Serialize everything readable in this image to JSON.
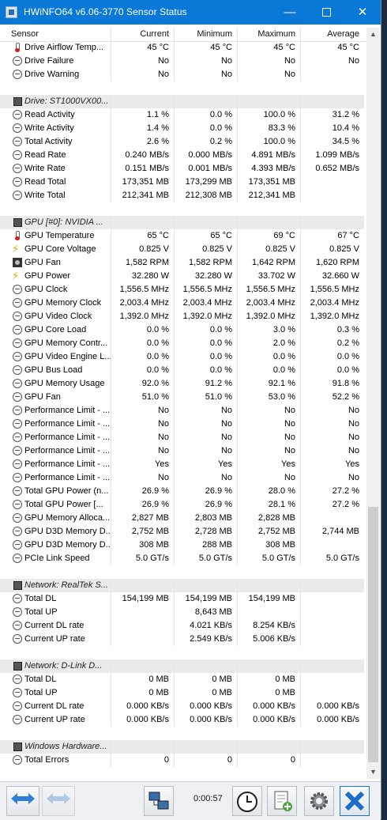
{
  "window": {
    "title": "HWiNFO64 v6.06-3770 Sensor Status",
    "minimize_glyph": "—",
    "close_glyph": "✕"
  },
  "columns": [
    "Sensor",
    "Current",
    "Minimum",
    "Maximum",
    "Average"
  ],
  "rows": [
    {
      "type": "sensor",
      "icon": "thermometer-icon",
      "label": "Drive Airflow Temp...",
      "v": [
        "45 °C",
        "45 °C",
        "45 °C",
        "45 °C"
      ]
    },
    {
      "type": "sensor",
      "icon": "clock-icon",
      "label": "Drive Failure",
      "v": [
        "No",
        "No",
        "No",
        "No"
      ]
    },
    {
      "type": "sensor",
      "icon": "clock-icon",
      "label": "Drive Warning",
      "v": [
        "No",
        "No",
        "No",
        ""
      ]
    },
    {
      "type": "blank"
    },
    {
      "type": "section",
      "icon": "drive-icon",
      "label": "Drive: ST1000VX00..."
    },
    {
      "type": "sensor",
      "icon": "clock-icon",
      "label": "Read Activity",
      "v": [
        "1.1 %",
        "0.0 %",
        "100.0 %",
        "31.2 %"
      ]
    },
    {
      "type": "sensor",
      "icon": "clock-icon",
      "label": "Write Activity",
      "v": [
        "1.4 %",
        "0.0 %",
        "83.3 %",
        "10.4 %"
      ]
    },
    {
      "type": "sensor",
      "icon": "clock-icon",
      "label": "Total Activity",
      "v": [
        "2.6 %",
        "0.2 %",
        "100.0 %",
        "34.5 %"
      ]
    },
    {
      "type": "sensor",
      "icon": "clock-icon",
      "label": "Read Rate",
      "v": [
        "0.240 MB/s",
        "0.000 MB/s",
        "4.891 MB/s",
        "1.099 MB/s"
      ]
    },
    {
      "type": "sensor",
      "icon": "clock-icon",
      "label": "Write Rate",
      "v": [
        "0.151 MB/s",
        "0.001 MB/s",
        "4.393 MB/s",
        "0.652 MB/s"
      ]
    },
    {
      "type": "sensor",
      "icon": "clock-icon",
      "label": "Read Total",
      "v": [
        "173,351 MB",
        "173,299 MB",
        "173,351 MB",
        ""
      ]
    },
    {
      "type": "sensor",
      "icon": "clock-icon",
      "label": "Write Total",
      "v": [
        "212,341 MB",
        "212,308 MB",
        "212,341 MB",
        ""
      ]
    },
    {
      "type": "blank"
    },
    {
      "type": "section",
      "icon": "gpu-icon",
      "label": "GPU [#0]: NVIDIA ..."
    },
    {
      "type": "sensor",
      "icon": "thermometer-icon",
      "label": "GPU Temperature",
      "v": [
        "65 °C",
        "65 °C",
        "69 °C",
        "67 °C"
      ]
    },
    {
      "type": "sensor",
      "icon": "voltage-icon",
      "label": "GPU Core Voltage",
      "v": [
        "0.825 V",
        "0.825 V",
        "0.825 V",
        "0.825 V"
      ]
    },
    {
      "type": "sensor",
      "icon": "fan-icon",
      "label": "GPU Fan",
      "v": [
        "1,582 RPM",
        "1,582 RPM",
        "1,642 RPM",
        "1,620 RPM"
      ]
    },
    {
      "type": "sensor",
      "icon": "voltage-icon",
      "label": "GPU Power",
      "v": [
        "32.280 W",
        "32.280 W",
        "33.702 W",
        "32.660 W"
      ]
    },
    {
      "type": "sensor",
      "icon": "clock-icon",
      "label": "GPU Clock",
      "v": [
        "1,556.5 MHz",
        "1,556.5 MHz",
        "1,556.5 MHz",
        "1,556.5 MHz"
      ]
    },
    {
      "type": "sensor",
      "icon": "clock-icon",
      "label": "GPU Memory Clock",
      "v": [
        "2,003.4 MHz",
        "2,003.4 MHz",
        "2,003.4 MHz",
        "2,003.4 MHz"
      ]
    },
    {
      "type": "sensor",
      "icon": "clock-icon",
      "label": "GPU Video Clock",
      "v": [
        "1,392.0 MHz",
        "1,392.0 MHz",
        "1,392.0 MHz",
        "1,392.0 MHz"
      ]
    },
    {
      "type": "sensor",
      "icon": "clock-icon",
      "label": "GPU Core Load",
      "v": [
        "0.0 %",
        "0.0 %",
        "3.0 %",
        "0.3 %"
      ]
    },
    {
      "type": "sensor",
      "icon": "clock-icon",
      "label": "GPU Memory Contr...",
      "v": [
        "0.0 %",
        "0.0 %",
        "2.0 %",
        "0.2 %"
      ]
    },
    {
      "type": "sensor",
      "icon": "clock-icon",
      "label": "GPU Video Engine L...",
      "v": [
        "0.0 %",
        "0.0 %",
        "0.0 %",
        "0.0 %"
      ]
    },
    {
      "type": "sensor",
      "icon": "clock-icon",
      "label": "GPU Bus Load",
      "v": [
        "0.0 %",
        "0.0 %",
        "0.0 %",
        "0.0 %"
      ]
    },
    {
      "type": "sensor",
      "icon": "clock-icon",
      "label": "GPU Memory Usage",
      "v": [
        "92.0 %",
        "91.2 %",
        "92.1 %",
        "91.8 %"
      ]
    },
    {
      "type": "sensor",
      "icon": "clock-icon",
      "label": "GPU Fan",
      "v": [
        "51.0 %",
        "51.0 %",
        "53.0 %",
        "52.2 %"
      ]
    },
    {
      "type": "sensor",
      "icon": "clock-icon",
      "label": "Performance Limit - ...",
      "v": [
        "No",
        "No",
        "No",
        "No"
      ]
    },
    {
      "type": "sensor",
      "icon": "clock-icon",
      "label": "Performance Limit - ...",
      "v": [
        "No",
        "No",
        "No",
        "No"
      ]
    },
    {
      "type": "sensor",
      "icon": "clock-icon",
      "label": "Performance Limit - ...",
      "v": [
        "No",
        "No",
        "No",
        "No"
      ]
    },
    {
      "type": "sensor",
      "icon": "clock-icon",
      "label": "Performance Limit - ...",
      "v": [
        "No",
        "No",
        "No",
        "No"
      ]
    },
    {
      "type": "sensor",
      "icon": "clock-icon",
      "label": "Performance Limit - ...",
      "v": [
        "Yes",
        "Yes",
        "Yes",
        "Yes"
      ]
    },
    {
      "type": "sensor",
      "icon": "clock-icon",
      "label": "Performance Limit - ...",
      "v": [
        "No",
        "No",
        "No",
        "No"
      ]
    },
    {
      "type": "sensor",
      "icon": "clock-icon",
      "label": "Total GPU Power (n...",
      "v": [
        "26.9 %",
        "26.9 %",
        "28.0 %",
        "27.2 %"
      ]
    },
    {
      "type": "sensor",
      "icon": "clock-icon",
      "label": "Total GPU Power [...",
      "v": [
        "26.9 %",
        "26.9 %",
        "28.1 %",
        "27.2 %"
      ]
    },
    {
      "type": "sensor",
      "icon": "clock-icon",
      "label": "GPU Memory Alloca...",
      "v": [
        "2,827 MB",
        "2,803 MB",
        "2,828 MB",
        ""
      ]
    },
    {
      "type": "sensor",
      "icon": "clock-icon",
      "label": "GPU D3D Memory D...",
      "v": [
        "2,752 MB",
        "2,728 MB",
        "2,752 MB",
        "2,744 MB"
      ]
    },
    {
      "type": "sensor",
      "icon": "clock-icon",
      "label": "GPU D3D Memory D...",
      "v": [
        "308 MB",
        "288 MB",
        "308 MB",
        ""
      ]
    },
    {
      "type": "sensor",
      "icon": "clock-icon",
      "label": "PCIe Link Speed",
      "v": [
        "5.0 GT/s",
        "5.0 GT/s",
        "5.0 GT/s",
        "5.0 GT/s"
      ]
    },
    {
      "type": "blank"
    },
    {
      "type": "section",
      "icon": "network-icon",
      "label": "Network: RealTek S..."
    },
    {
      "type": "sensor",
      "icon": "clock-icon",
      "label": "Total DL",
      "v": [
        "154,199 MB",
        "154,199 MB",
        "154,199 MB",
        ""
      ]
    },
    {
      "type": "sensor",
      "icon": "clock-icon",
      "label": "Total UP",
      "v": [
        "",
        "8,643 MB",
        "",
        ""
      ]
    },
    {
      "type": "sensor",
      "icon": "clock-icon",
      "label": "Current DL rate",
      "v": [
        "",
        "4.021 KB/s",
        "8.254 KB/s",
        ""
      ]
    },
    {
      "type": "sensor",
      "icon": "clock-icon",
      "label": "Current UP rate",
      "v": [
        "",
        "2.549 KB/s",
        "5.006 KB/s",
        ""
      ]
    },
    {
      "type": "blank"
    },
    {
      "type": "section",
      "icon": "network-icon",
      "label": "Network: D-Link D..."
    },
    {
      "type": "sensor",
      "icon": "clock-icon",
      "label": "Total DL",
      "v": [
        "0 MB",
        "0 MB",
        "0 MB",
        ""
      ]
    },
    {
      "type": "sensor",
      "icon": "clock-icon",
      "label": "Total UP",
      "v": [
        "0 MB",
        "0 MB",
        "0 MB",
        ""
      ]
    },
    {
      "type": "sensor",
      "icon": "clock-icon",
      "label": "Current DL rate",
      "v": [
        "0.000 KB/s",
        "0.000 KB/s",
        "0.000 KB/s",
        "0.000 KB/s"
      ]
    },
    {
      "type": "sensor",
      "icon": "clock-icon",
      "label": "Current UP rate",
      "v": [
        "0.000 KB/s",
        "0.000 KB/s",
        "0.000 KB/s",
        "0.000 KB/s"
      ]
    },
    {
      "type": "blank"
    },
    {
      "type": "section",
      "icon": "hardware-icon",
      "label": "Windows Hardware..."
    },
    {
      "type": "sensor",
      "icon": "clock-icon",
      "label": "Total Errors",
      "v": [
        "0",
        "0",
        "0",
        ""
      ]
    }
  ],
  "toolbar": {
    "elapsed": "0:00:57"
  },
  "colors": {
    "title_bar": "#0a78d7",
    "section_bg": "#eaeaea",
    "close_button_accent": "#1976d2"
  }
}
